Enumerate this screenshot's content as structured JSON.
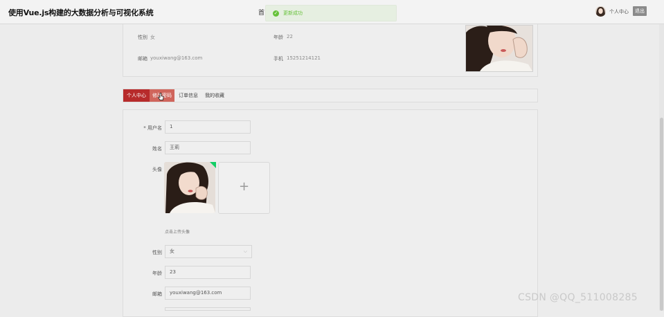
{
  "header": {
    "app_title": "使用Vue.js构建的大数据分析与可视化系统",
    "nav_partial": "首",
    "toast_text": "更新成功",
    "user_center": "个人中心",
    "logout": "退出"
  },
  "info": {
    "gender_label": "性别",
    "gender_value": "女",
    "age_label": "年龄",
    "age_value": "22",
    "email_label": "邮箱",
    "email_value": "youxiwang@163.com",
    "phone_label": "手机",
    "phone_value": "15251214121"
  },
  "tabs": [
    "个人中心",
    "修改密码",
    "订单信息",
    "我的收藏"
  ],
  "form": {
    "username_label": "* 用户名",
    "username_value": "1",
    "name_label": "姓名",
    "name_value": "王莉",
    "avatar_label": "头像",
    "upload_plus": "+",
    "upload_hint": "点击上传头像",
    "gender_label": "性别",
    "gender_value": "女",
    "age_label": "年龄",
    "age_value": "23",
    "email_label": "邮箱",
    "email_value": "youxiwang@163.com"
  },
  "watermark": "CSDN @QQ_511008285",
  "colors": {
    "accent": "#b72b2b",
    "success": "#67c23a"
  }
}
